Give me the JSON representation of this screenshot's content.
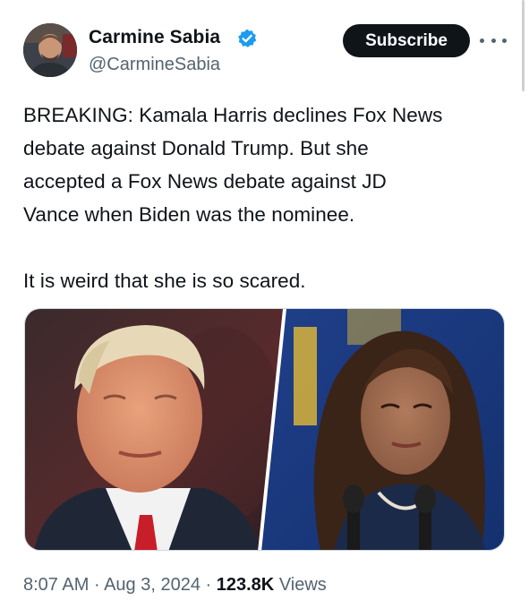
{
  "author": {
    "display_name": "Carmine Sabia",
    "handle": "@CarmineSabia",
    "verified": true,
    "verified_color": "#1d9bf0"
  },
  "subscribe_label": "Subscribe",
  "tweet": {
    "lines": [
      "BREAKING: Kamala Harris declines Fox News",
      "debate against Donald Trump. But she",
      "accepted a Fox News debate against JD",
      "Vance when Biden was the nominee."
    ],
    "second_paragraph": "It is weird that she is so scared."
  },
  "meta": {
    "time": "8:07 AM",
    "separator": "·",
    "date": "Aug 3, 2024",
    "views_count": "123.8K",
    "views_label": "Views"
  }
}
